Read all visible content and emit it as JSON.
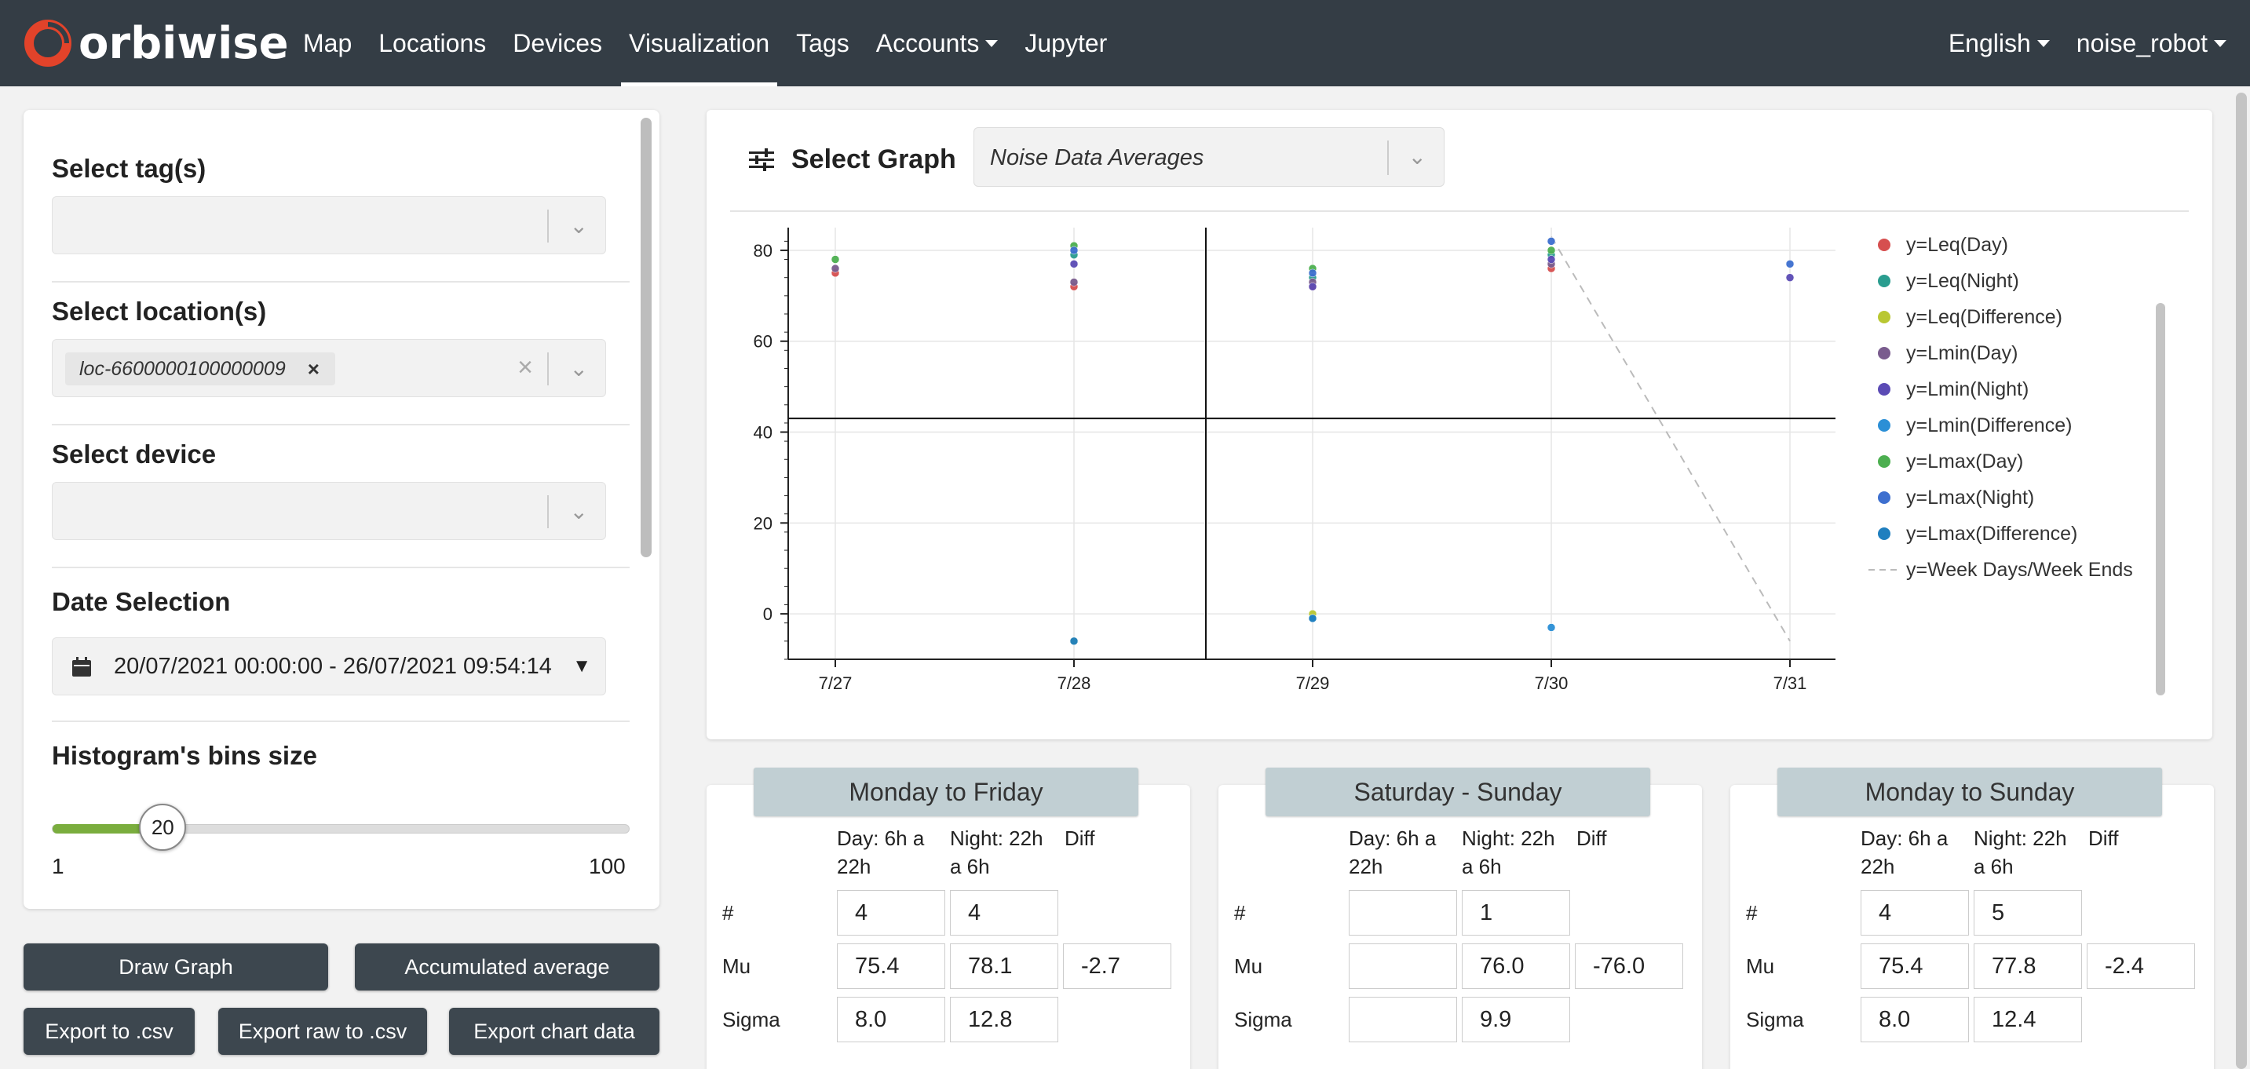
{
  "navbar": {
    "brand": "orbiwise",
    "items": [
      {
        "label": "Map",
        "active": false,
        "dropdown": false
      },
      {
        "label": "Locations",
        "active": false,
        "dropdown": false
      },
      {
        "label": "Devices",
        "active": false,
        "dropdown": false
      },
      {
        "label": "Visualization",
        "active": true,
        "dropdown": false
      },
      {
        "label": "Tags",
        "active": false,
        "dropdown": false
      },
      {
        "label": "Accounts",
        "active": false,
        "dropdown": true
      },
      {
        "label": "Jupyter",
        "active": false,
        "dropdown": false
      }
    ],
    "language": "English",
    "user": "noise_robot"
  },
  "filters": {
    "tags_title": "Select tag(s)",
    "locations_title": "Select location(s)",
    "selected_location": "loc-6600000100000009",
    "device_title": "Select device",
    "date_title": "Date Selection",
    "date_range": "20/07/2021 00:00:00 - 26/07/2021 09:54:14",
    "bins_title": "Histogram's bins size",
    "bins_value": "20",
    "bins_min": "1",
    "bins_max": "100",
    "bins_fraction": 0.192
  },
  "buttons": {
    "draw": "Draw Graph",
    "accumulated": "Accumulated average",
    "export_csv": "Export to .csv",
    "export_raw": "Export raw to .csv",
    "export_chart": "Export chart data"
  },
  "graph": {
    "select_label": "Select Graph",
    "selected": "Noise Data Averages"
  },
  "chart_data": {
    "type": "scatter",
    "categories": [
      "7/27",
      "7/28",
      "7/29",
      "7/30",
      "7/31"
    ],
    "yticks": [
      0,
      20,
      40,
      60,
      80
    ],
    "ylim": [
      -10,
      85
    ],
    "crosshair": {
      "x": "7/28 12:00",
      "y": 43
    },
    "series": [
      {
        "name": "y=Leq(Day)",
        "color": "#d64f4f",
        "values": [
          75,
          72,
          72,
          76,
          null
        ]
      },
      {
        "name": "y=Leq(Night)",
        "color": "#2a9d8f",
        "values": [
          null,
          79,
          74,
          79,
          null
        ]
      },
      {
        "name": "y=Leq(Difference)",
        "color": "#b9c732",
        "values": [
          null,
          -6,
          0,
          null,
          null
        ]
      },
      {
        "name": "y=Lmin(Day)",
        "color": "#7a5c8e",
        "values": [
          76,
          73,
          73,
          77,
          null
        ]
      },
      {
        "name": "y=Lmin(Night)",
        "color": "#5b4bb5",
        "values": [
          null,
          77,
          72,
          78,
          74
        ]
      },
      {
        "name": "y=Lmin(Difference)",
        "color": "#2b8fd6",
        "values": [
          null,
          null,
          -1,
          -3,
          null
        ]
      },
      {
        "name": "y=Lmax(Day)",
        "color": "#4caf50",
        "values": [
          78,
          81,
          76,
          80,
          null
        ]
      },
      {
        "name": "y=Lmax(Night)",
        "color": "#3d6fcf",
        "values": [
          null,
          80,
          75,
          82,
          77
        ]
      },
      {
        "name": "y=Lmax(Difference)",
        "color": "#1f7fbf",
        "values": [
          null,
          -6,
          -1,
          null,
          null
        ]
      }
    ],
    "week_line": {
      "name": "y=Week Days/Week Ends",
      "from": {
        "x": "7/30",
        "y": 83
      },
      "to": {
        "x": "7/31",
        "y": -6
      }
    }
  },
  "stats": {
    "col_day": [
      "Day: 6h a",
      "22h"
    ],
    "col_night": [
      "Night: 22h",
      "a 6h"
    ],
    "col_diff": "Diff",
    "row_count": "#",
    "row_mu": "Mu",
    "row_sigma": "Sigma",
    "cards": [
      {
        "title": "Monday to Friday",
        "count_day": "4",
        "count_night": "4",
        "mu_day": "75.4",
        "mu_night": "78.1",
        "mu_diff": "-2.7",
        "sigma_day": "8.0",
        "sigma_night": "12.8"
      },
      {
        "title": "Saturday - Sunday",
        "count_day": "",
        "count_night": "1",
        "mu_day": "",
        "mu_night": "76.0",
        "mu_diff": "-76.0",
        "sigma_day": "",
        "sigma_night": "9.9"
      },
      {
        "title": "Monday to Sunday",
        "count_day": "4",
        "count_night": "5",
        "mu_day": "75.4",
        "mu_night": "77.8",
        "mu_diff": "-2.4",
        "sigma_day": "8.0",
        "sigma_night": "12.4"
      }
    ]
  }
}
